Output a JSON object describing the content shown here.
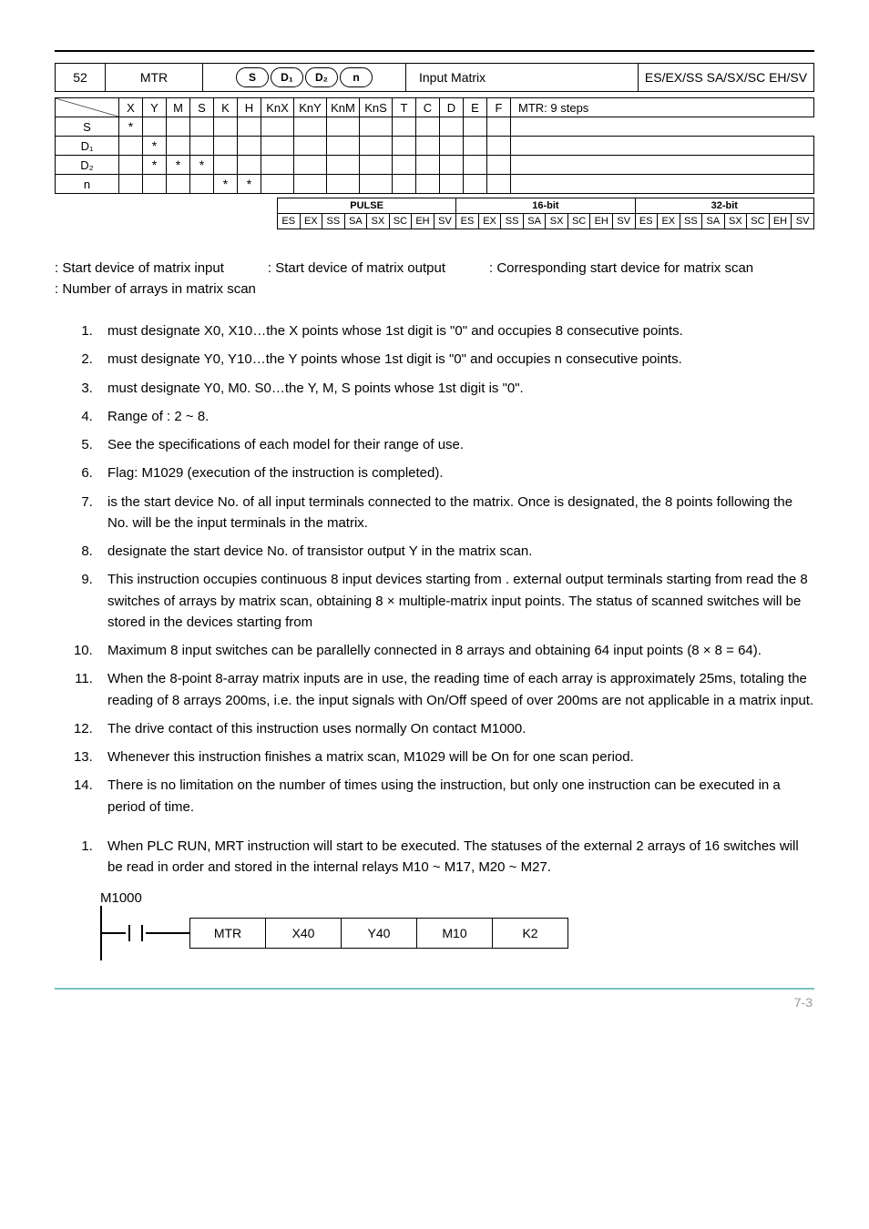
{
  "header": {
    "num": "52",
    "mnemonic": "MTR",
    "ops": [
      "S",
      "D₁",
      "D₂",
      "n"
    ],
    "title": "Input Matrix",
    "models": "ES/EX/SS SA/SX/SC EH/SV"
  },
  "operand_table": {
    "cols": [
      "X",
      "Y",
      "M",
      "S",
      "K",
      "H",
      "KnX",
      "KnY",
      "KnM",
      "KnS",
      "T",
      "C",
      "D",
      "E",
      "F"
    ],
    "rows": [
      {
        "label": "S",
        "stars": [
          "X"
        ]
      },
      {
        "label": "D₁",
        "stars": [
          "Y"
        ]
      },
      {
        "label": "D₂",
        "stars": [
          "Y",
          "M",
          "S"
        ]
      },
      {
        "label": "n",
        "stars": [
          "K",
          "H"
        ]
      }
    ],
    "steps": "MTR: 9 steps"
  },
  "subtable": {
    "heads": [
      "PULSE",
      "16-bit",
      "32-bit"
    ],
    "cells": [
      "ES",
      "EX",
      "SS",
      "SA",
      "SX",
      "SC",
      "EH",
      "SV"
    ]
  },
  "legend": {
    "a": ": Start device of matrix input",
    "b": ": Start device of matrix output",
    "c": ": Corresponding start device for matrix scan",
    "d": ": Number of arrays in matrix scan"
  },
  "explain": [
    " must designate X0, X10…the X points whose 1st digit is \"0\" and occupies 8 consecutive points.",
    " must designate Y0, Y10…the Y points whose 1st digit is \"0\" and occupies n consecutive points.",
    " must designate Y0, M0. S0…the Y, M, S points whose 1st digit is \"0\".",
    "Range of   : 2 ~ 8.",
    "See the specifications of each model for their range of use.",
    "Flag: M1029 (execution of the instruction is completed).",
    " is the start device No. of all input terminals connected to the matrix. Once   is designated, the 8 points following the No. will be the input terminals in the matrix.",
    " designate the start device No. of transistor output Y in the matrix scan.",
    "This instruction occupies continuous 8 input devices starting from   .   external output terminals starting from   read the 8 switches of   arrays by matrix scan, obtaining 8 ×   multiple-matrix input points. The status of scanned switches will be stored in the devices starting from",
    "Maximum 8 input switches can be parallelly connected in 8 arrays and obtaining 64 input points (8 × 8 = 64).",
    "When the 8-point 8-array matrix inputs are in use, the reading time of each array is approximately 25ms, totaling the reading of 8 arrays 200ms, i.e. the input signals with On/Off speed of over 200ms are not applicable in a matrix input.",
    "The drive contact of this instruction uses normally On contact M1000.",
    "Whenever this instruction finishes a matrix scan, M1029 will be On for one scan period.",
    "There is no limitation on the number of times using the instruction, but only one instruction can be executed in a period of time."
  ],
  "example_intro": "When PLC RUN, MRT instruction will start to be executed. The statuses of the external 2 arrays of 16 switches will be read in order and stored in the internal relays M10 ~ M17, M20 ~ M27.",
  "ladder": {
    "coil_label": "M1000",
    "cells": [
      "MTR",
      "X40",
      "Y40",
      "M10",
      "K2"
    ]
  },
  "footer": "7-3"
}
